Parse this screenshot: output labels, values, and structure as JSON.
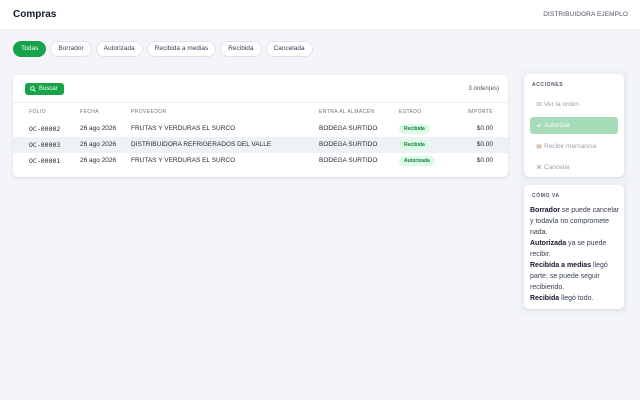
{
  "header": {
    "title": "Compras",
    "org": "DISTRIBUIDORA EJEMPLO"
  },
  "filters": [
    {
      "label": "Todas",
      "active": true
    },
    {
      "label": "Borrador",
      "active": false
    },
    {
      "label": "Autorizada",
      "active": false
    },
    {
      "label": "Recibida a medias",
      "active": false
    },
    {
      "label": "Recibida",
      "active": false
    },
    {
      "label": "Cancelada",
      "active": false
    }
  ],
  "orders": {
    "search_label": "Buscar",
    "count": "3 orden(es)",
    "columns": [
      "FOLIO",
      "FECHA",
      "PROVEEDOR",
      "ENTRA AL ALMACÉN",
      "ESTADO",
      "IMPORTE"
    ],
    "rows": [
      {
        "folio": "OC-00002",
        "fecha": "26 ago 2026",
        "proveedor": "FRUTAS Y VERDURAS EL SURCO",
        "almacen": "BODEGA SURTIDO",
        "estado": "Recibida",
        "importe": "$0.00"
      },
      {
        "folio": "OC-00003",
        "fecha": "26 ago 2026",
        "proveedor": "DISTRIBUIDORA REFRIGERADOS DEL VALLE",
        "almacen": "BODEGA SURTIDO",
        "estado": "Recibida",
        "importe": "$0.00"
      },
      {
        "folio": "OC-00001",
        "fecha": "26 ago 2026",
        "proveedor": "FRUTAS Y VERDURAS EL SURCO",
        "almacen": "BODEGA SURTIDO",
        "estado": "Autorizada",
        "importe": "$0.00"
      }
    ]
  },
  "actions": {
    "title": "ACCIONES",
    "items": [
      {
        "label": "Ver la orden",
        "icon": "eye-icon",
        "enabled": false
      },
      {
        "label": "Autorizar",
        "icon": "check-icon",
        "enabled": true
      },
      {
        "label": "Recibir mercancía",
        "icon": "box-icon",
        "enabled": false
      },
      {
        "label": "Cancelar",
        "icon": "x-icon",
        "enabled": false
      }
    ]
  },
  "help": {
    "title": "CÓMO VA",
    "lines": [
      {
        "term": "Borrador",
        "text": " se puede cancelar y todavía no compromete nada."
      },
      {
        "term": "Autorizada",
        "text": " ya se puede recibir."
      },
      {
        "term": "Recibida a medias",
        "text": " llegó parte; se puede seguir recibiendo."
      },
      {
        "term": "Recibida",
        "text": " llegó todo."
      }
    ]
  },
  "colors": {
    "accent": "#16a34a",
    "accent_soft": "#a7dcb9",
    "badge_bg": "#dcfce7",
    "badge_text": "#15803d"
  }
}
